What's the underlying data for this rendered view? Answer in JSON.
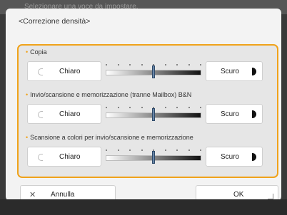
{
  "header": {
    "title": "Selezionare una voce da impostare."
  },
  "dialog": {
    "title": "<Correzione densità>",
    "sections": [
      {
        "label": "Copia",
        "light_label": "Chiaro",
        "dark_label": "Scuro",
        "level": 0.5
      },
      {
        "label": "Invio/scansione e memorizzazione (tranne Mailbox) B&N",
        "light_label": "Chiaro",
        "dark_label": "Scuro",
        "level": 0.5
      },
      {
        "label": "Scansione a colori per invio/scansione e memorizzazione",
        "light_label": "Chiaro",
        "dark_label": "Scuro",
        "level": 0.5
      }
    ],
    "slider_steps": 9,
    "cancel_label": "Annulla",
    "ok_label": "OK"
  },
  "colors": {
    "accent": "#f0a21a",
    "thumb": "#6a86a6"
  },
  "icons": {
    "light": "half-circle-light-icon",
    "dark": "half-circle-dark-icon",
    "cancel": "close-icon",
    "ok": "corner-arrow-icon"
  }
}
